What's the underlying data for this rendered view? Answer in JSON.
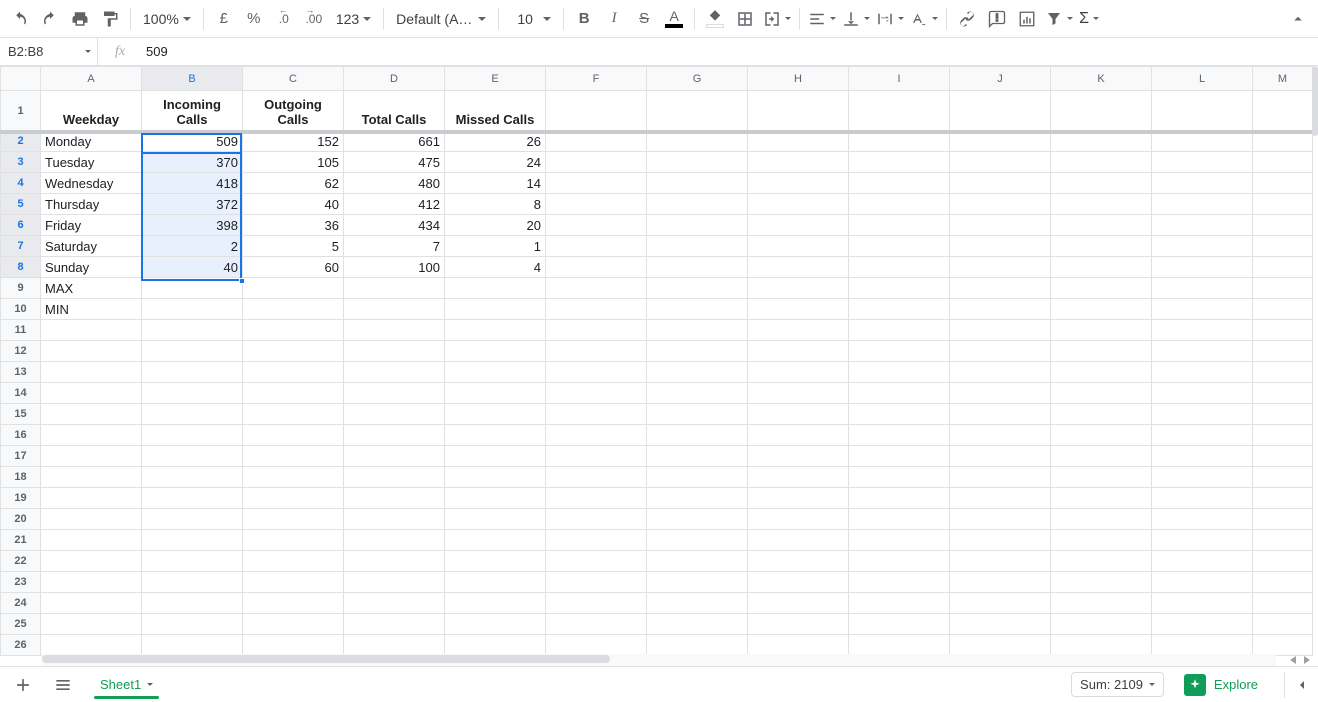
{
  "toolbar": {
    "zoom": "100%",
    "currency": "£",
    "percent": "%",
    "dec_decrease": ".0",
    "dec_increase": ".00",
    "more_formats": "123",
    "font_family": "Default (Ari...",
    "font_size": "10"
  },
  "namebox": {
    "ref": "B2:B8",
    "formula": "509"
  },
  "columns": [
    "A",
    "B",
    "C",
    "D",
    "E",
    "F",
    "G",
    "H",
    "I",
    "J",
    "K",
    "L",
    "M"
  ],
  "headers": {
    "A": "Weekday",
    "B": "Incoming Calls",
    "C": "Outgoing Calls",
    "D": "Total Calls",
    "E": "Missed Calls"
  },
  "rows": [
    {
      "n": 2,
      "A": "Monday",
      "B": 509,
      "C": 152,
      "D": 661,
      "E": 26
    },
    {
      "n": 3,
      "A": "Tuesday",
      "B": 370,
      "C": 105,
      "D": 475,
      "E": 24
    },
    {
      "n": 4,
      "A": "Wednesday",
      "B": 418,
      "C": 62,
      "D": 480,
      "E": 14
    },
    {
      "n": 5,
      "A": "Thursday",
      "B": 372,
      "C": 40,
      "D": 412,
      "E": 8
    },
    {
      "n": 6,
      "A": "Friday",
      "B": 398,
      "C": 36,
      "D": 434,
      "E": 20
    },
    {
      "n": 7,
      "A": "Saturday",
      "B": 2,
      "C": 5,
      "D": 7,
      "E": 1
    },
    {
      "n": 8,
      "A": "Sunday",
      "B": 40,
      "C": 60,
      "D": 100,
      "E": 4
    }
  ],
  "extra_rows": [
    {
      "n": 9,
      "A": "MAX"
    },
    {
      "n": 10,
      "A": "MIN"
    }
  ],
  "empty_rows": [
    11,
    12,
    13,
    14,
    15,
    16,
    17,
    18,
    19,
    20,
    21,
    22,
    23,
    24,
    25,
    26
  ],
  "selection": {
    "active": "B2",
    "range": "B2:B8",
    "selected_col": "B",
    "selected_rows": [
      2,
      3,
      4,
      5,
      6,
      7,
      8
    ]
  },
  "bottom": {
    "sheet_name": "Sheet1",
    "summary": "Sum: 2109",
    "explore": "Explore"
  }
}
